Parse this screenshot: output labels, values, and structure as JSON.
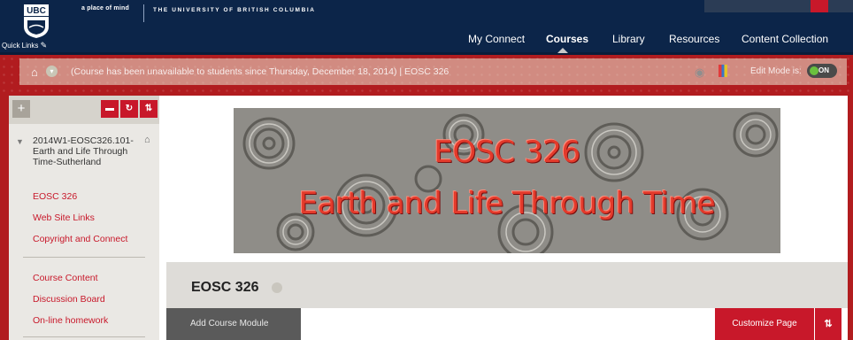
{
  "header": {
    "logo_text": "UBC",
    "tagline": "a place of mind",
    "university_name": "THE UNIVERSITY OF BRITISH COLUMBIA",
    "quick_links": "Quick Links",
    "nav": [
      {
        "label": "My Connect"
      },
      {
        "label": "Courses",
        "active": true
      },
      {
        "label": "Library"
      },
      {
        "label": "Resources"
      },
      {
        "label": "Content Collection"
      }
    ]
  },
  "breadcrumb": {
    "text": "(Course has been unavailable to students since Thursday, December 18, 2014) | EOSC 326",
    "edit_mode_label": "Edit Mode is:",
    "edit_mode_value": "ON"
  },
  "sidebar": {
    "course_title": "2014W1-EOSC326.101-Earth and Life Through Time-Sutherland",
    "group1": [
      "EOSC 326",
      "Web Site Links",
      "Copyright and Connect"
    ],
    "group2": [
      "Course Content",
      "Discussion Board",
      "On-line homework"
    ]
  },
  "hero": {
    "line1": "EOSC 326",
    "line2": "Earth and Life Through Time"
  },
  "page": {
    "title": "EOSC 326",
    "add_module": "Add Course Module",
    "customize": "Customize Page"
  },
  "colors": {
    "header_bg": "#0c2549",
    "accent_red": "#c8182a",
    "banner_red": "#b11c1f"
  }
}
